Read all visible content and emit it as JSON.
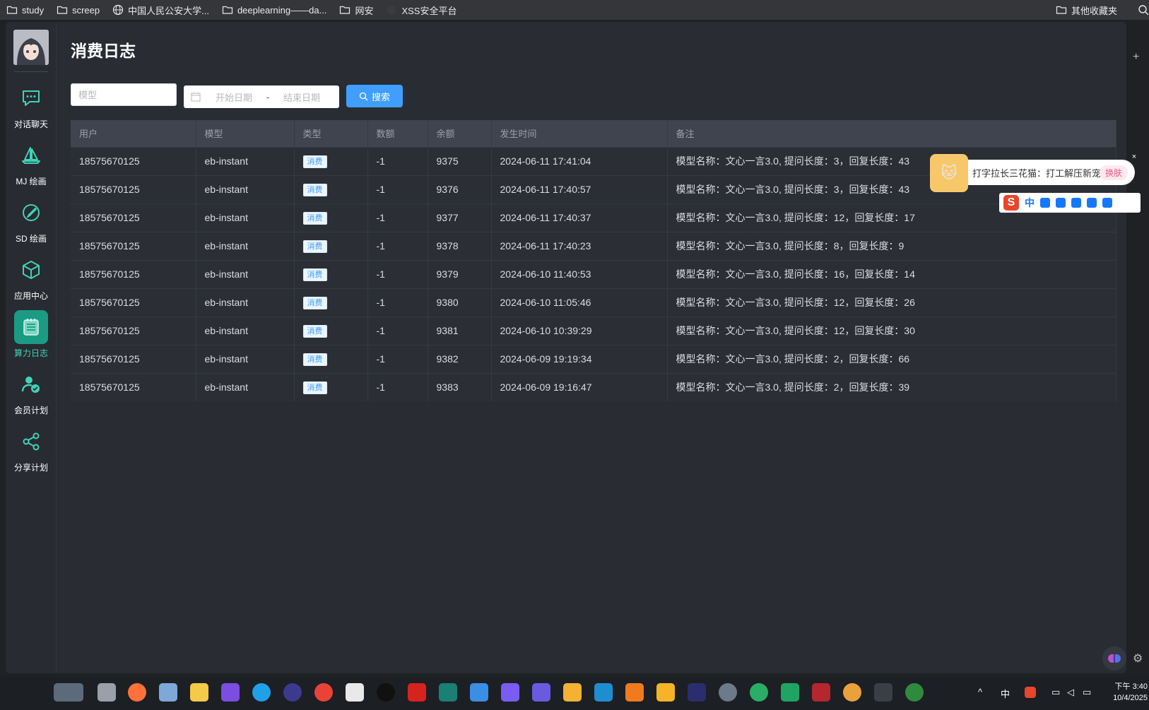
{
  "bookmarks": {
    "items": [
      "study",
      "screep",
      "中国人民公安大学...",
      "deeplearning——da...",
      "网安",
      "XSS安全平台"
    ],
    "other": "其他收藏夹"
  },
  "sidebar": {
    "items": [
      {
        "label": "对话聊天",
        "icon": "chat-icon"
      },
      {
        "label": "MJ 绘画",
        "icon": "sailboat-icon"
      },
      {
        "label": "SD 绘画",
        "icon": "brush-icon"
      },
      {
        "label": "应用中心",
        "icon": "cube-icon"
      },
      {
        "label": "算力日志",
        "icon": "notebook-icon"
      },
      {
        "label": "会员计划",
        "icon": "user-check-icon"
      },
      {
        "label": "分享计划",
        "icon": "share-icon"
      }
    ]
  },
  "page": {
    "title": "消费日志",
    "model_placeholder": "模型",
    "start_date_placeholder": "开始日期",
    "date_separator": "-",
    "end_date_placeholder": "结束日期",
    "search_label": "搜索"
  },
  "table": {
    "headers": [
      "用户",
      "模型",
      "类型",
      "数额",
      "余额",
      "发生时间",
      "备注"
    ],
    "rows": [
      [
        "18575670125",
        "eb-instant",
        "消费",
        "-1",
        "9375",
        "2024-06-11 17:41:04",
        "模型名称：文心一言3.0, 提问长度：3，回复长度：43"
      ],
      [
        "18575670125",
        "eb-instant",
        "消费",
        "-1",
        "9376",
        "2024-06-11 17:40:57",
        "模型名称：文心一言3.0, 提问长度：3，回复长度：43"
      ],
      [
        "18575670125",
        "eb-instant",
        "消费",
        "-1",
        "9377",
        "2024-06-11 17:40:37",
        "模型名称：文心一言3.0, 提问长度：12，回复长度：17"
      ],
      [
        "18575670125",
        "eb-instant",
        "消费",
        "-1",
        "9378",
        "2024-06-11 17:40:23",
        "模型名称：文心一言3.0, 提问长度：8，回复长度：9"
      ],
      [
        "18575670125",
        "eb-instant",
        "消费",
        "-1",
        "9379",
        "2024-06-10 11:40:53",
        "模型名称：文心一言3.0, 提问长度：16，回复长度：14"
      ],
      [
        "18575670125",
        "eb-instant",
        "消费",
        "-1",
        "9380",
        "2024-06-10 11:05:46",
        "模型名称：文心一言3.0, 提问长度：12，回复长度：26"
      ],
      [
        "18575670125",
        "eb-instant",
        "消费",
        "-1",
        "9381",
        "2024-06-10 10:39:29",
        "模型名称：文心一言3.0, 提问长度：12，回复长度：30"
      ],
      [
        "18575670125",
        "eb-instant",
        "消费",
        "-1",
        "9382",
        "2024-06-09 19:19:34",
        "模型名称：文心一言3.0, 提问长度：2，回复长度：66"
      ],
      [
        "18575670125",
        "eb-instant",
        "消费",
        "-1",
        "9383",
        "2024-06-09 19:16:47",
        "模型名称：文心一言3.0, 提问长度：2，回复长度：39"
      ]
    ]
  },
  "ime": {
    "popup_text": "打字拉长三花猫：打工解压新宠",
    "switch_label": "换肤",
    "mode": "中"
  },
  "taskbar": {
    "input_mode": "中",
    "time": "下午 3:40",
    "date": "10/4/2025"
  },
  "colors": {
    "accent": "#409eff",
    "active_nav": "#1b9b83",
    "negative": "#f56c6c"
  }
}
